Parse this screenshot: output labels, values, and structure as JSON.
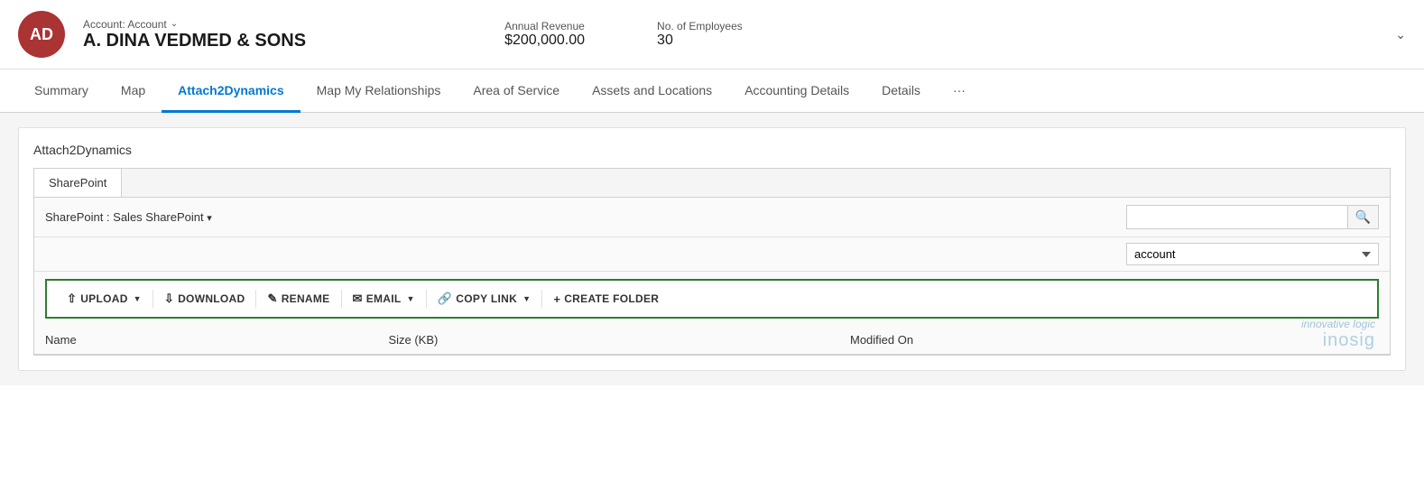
{
  "header": {
    "avatar_initials": "AD",
    "avatar_bg": "#a33333",
    "account_label": "Account: Account",
    "account_name": "A. DINA VEDMED & SONS",
    "annual_revenue_label": "Annual Revenue",
    "annual_revenue_value": "$200,000.00",
    "employees_label": "No. of Employees",
    "employees_value": "30"
  },
  "nav": {
    "tabs": [
      {
        "id": "summary",
        "label": "Summary",
        "active": false
      },
      {
        "id": "map",
        "label": "Map",
        "active": false
      },
      {
        "id": "attach2dynamics",
        "label": "Attach2Dynamics",
        "active": true
      },
      {
        "id": "map-my-relationships",
        "label": "Map My Relationships",
        "active": false
      },
      {
        "id": "area-of-service",
        "label": "Area of Service",
        "active": false
      },
      {
        "id": "assets-and-locations",
        "label": "Assets and Locations",
        "active": false
      },
      {
        "id": "accounting-details",
        "label": "Accounting Details",
        "active": false
      },
      {
        "id": "details",
        "label": "Details",
        "active": false
      },
      {
        "id": "more",
        "label": "···",
        "active": false
      }
    ]
  },
  "content": {
    "section_title": "Attach2Dynamics",
    "inner_tab_label": "SharePoint",
    "sharepoint_label": "SharePoint : Sales SharePoint",
    "search_placeholder": "",
    "dropdown_value": "account",
    "toolbar": {
      "upload_label": "UPLOAD",
      "download_label": "DOWNLOAD",
      "rename_label": "RENAME",
      "email_label": "EMAIL",
      "copy_link_label": "COPY LINK",
      "create_folder_label": "CREATE FOLDER"
    },
    "table_headers": [
      {
        "id": "name",
        "label": "Name"
      },
      {
        "id": "size",
        "label": "Size (KB)"
      },
      {
        "id": "modified_on",
        "label": "Modified On"
      }
    ],
    "watermark_text": "innovative logic",
    "watermark_logo": "inosig"
  }
}
